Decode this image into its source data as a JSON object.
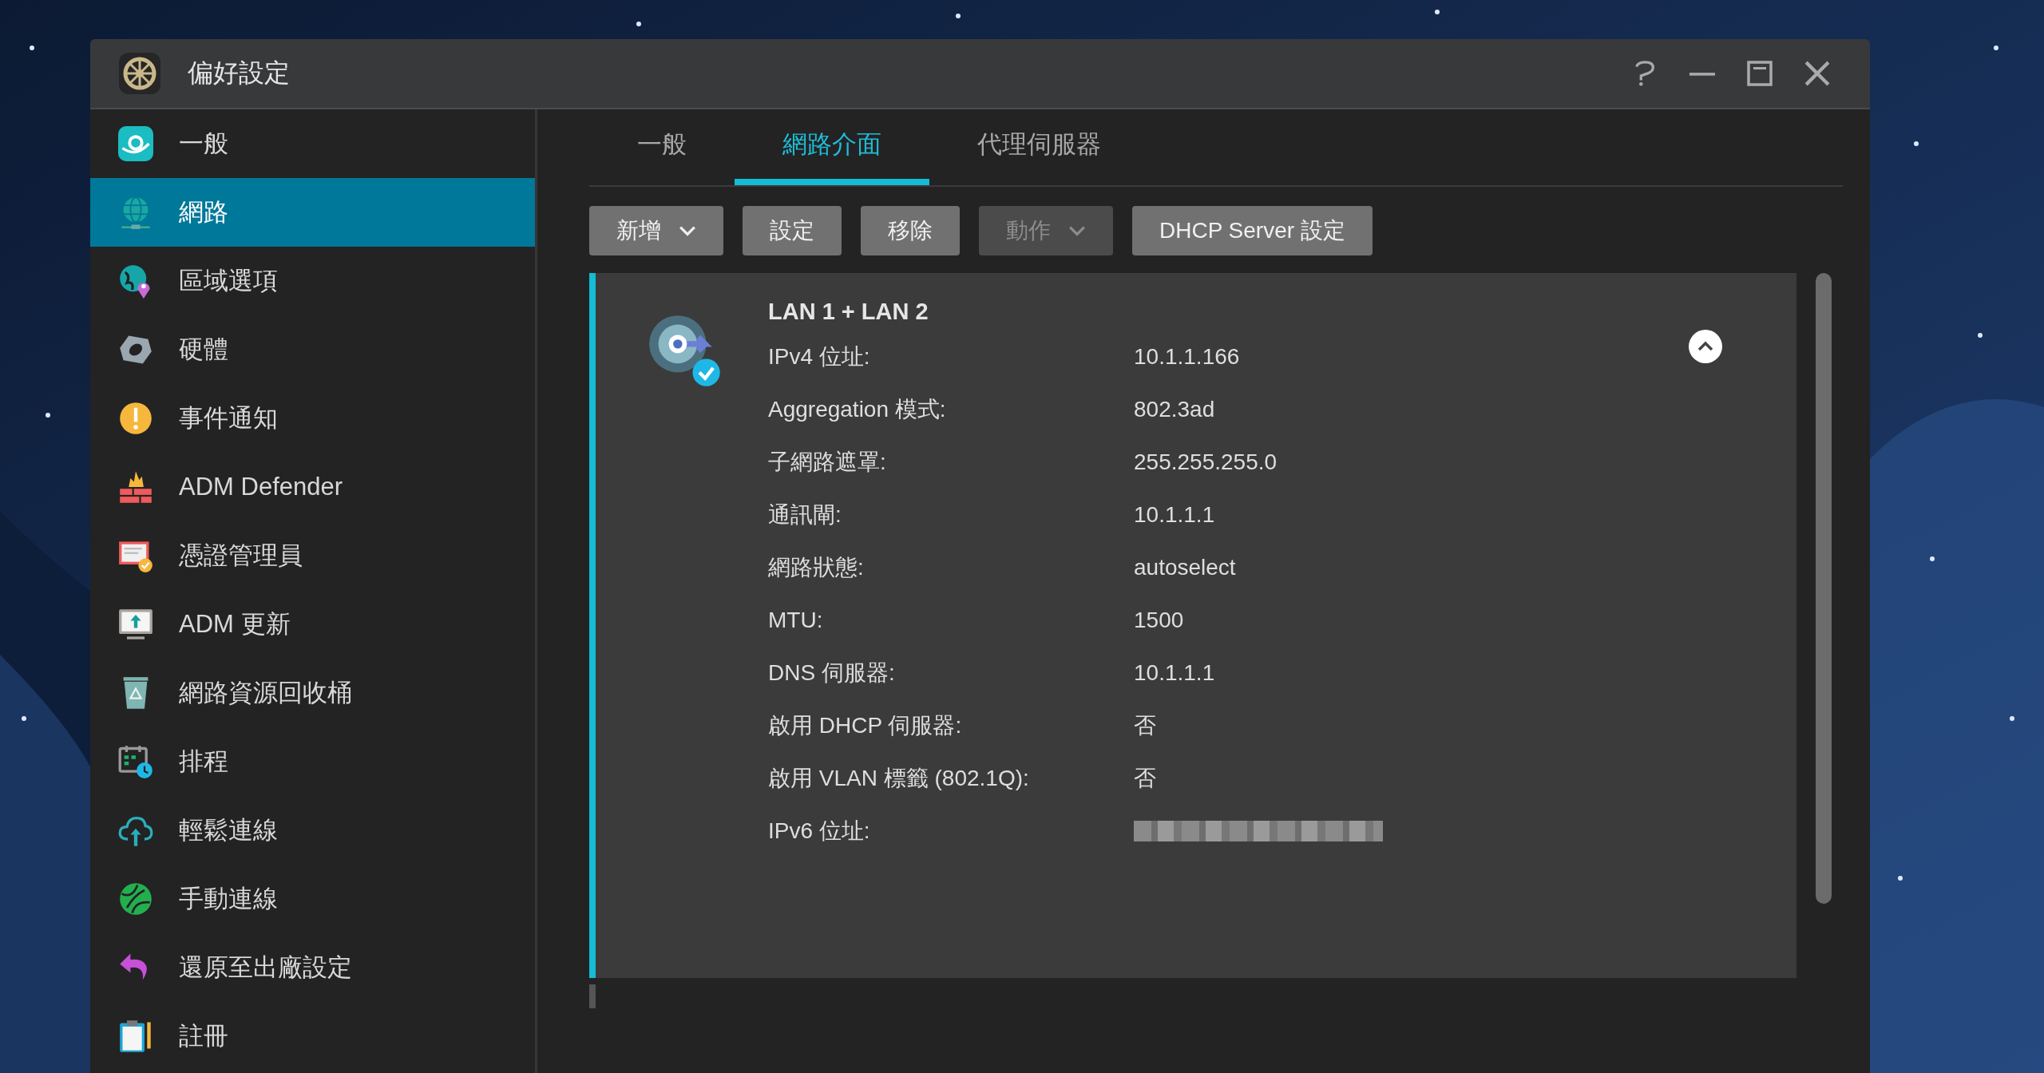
{
  "window": {
    "title": "偏好設定"
  },
  "sidebar": {
    "items": [
      {
        "label": "一般",
        "selected": false
      },
      {
        "label": "網路",
        "selected": true
      },
      {
        "label": "區域選項",
        "selected": false
      },
      {
        "label": "硬體",
        "selected": false
      },
      {
        "label": "事件通知",
        "selected": false
      },
      {
        "label": "ADM Defender",
        "selected": false
      },
      {
        "label": "憑證管理員",
        "selected": false
      },
      {
        "label": "ADM 更新",
        "selected": false
      },
      {
        "label": "網路資源回收桶",
        "selected": false
      },
      {
        "label": "排程",
        "selected": false
      },
      {
        "label": "輕鬆連線",
        "selected": false
      },
      {
        "label": "手動連線",
        "selected": false
      },
      {
        "label": "還原至出廠設定",
        "selected": false
      },
      {
        "label": "註冊",
        "selected": false
      }
    ]
  },
  "tabs": [
    {
      "label": "一般",
      "selected": false
    },
    {
      "label": "網路介面",
      "selected": true
    },
    {
      "label": "代理伺服器",
      "selected": false
    }
  ],
  "toolbar": {
    "buttons": [
      {
        "label": "新增",
        "dropdown": true,
        "disabled": false
      },
      {
        "label": "設定",
        "dropdown": false,
        "disabled": false
      },
      {
        "label": "移除",
        "dropdown": false,
        "disabled": false
      },
      {
        "label": "動作",
        "dropdown": true,
        "disabled": true
      },
      {
        "label": "DHCP Server 設定",
        "dropdown": false,
        "disabled": false
      }
    ]
  },
  "interface": {
    "title": "LAN 1 + LAN 2",
    "expanded": true,
    "rows": [
      {
        "label": "IPv4 位址:",
        "value": "10.1.1.166"
      },
      {
        "label": "Aggregation 模式:",
        "value": "802.3ad"
      },
      {
        "label": "子網路遮罩:",
        "value": "255.255.255.0"
      },
      {
        "label": "通訊閘:",
        "value": "10.1.1.1"
      },
      {
        "label": "網路狀態:",
        "value": "autoselect"
      },
      {
        "label": "MTU:",
        "value": "1500"
      },
      {
        "label": "DNS 伺服器:",
        "value": "10.1.1.1"
      },
      {
        "label": "啟用 DHCP 伺服器:",
        "value": "否"
      },
      {
        "label": "啟用 VLAN 標籤 (802.1Q):",
        "value": "否"
      },
      {
        "label": "IPv6 位址:",
        "redacted": true
      }
    ]
  }
}
